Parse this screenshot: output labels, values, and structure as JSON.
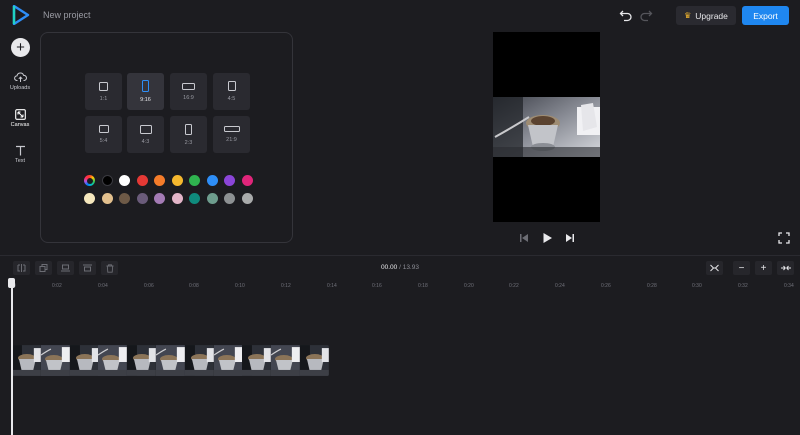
{
  "header": {
    "project_name": "New project",
    "upgrade_label": "Upgrade",
    "export_label": "Export",
    "upgrade_icon": "crown-icon",
    "brand_color": "#1f87f0"
  },
  "sidebar": {
    "add_icon": "plus-icon",
    "items": [
      {
        "label": "Uploads",
        "icon": "cloud-upload-icon"
      },
      {
        "label": "Canvas",
        "icon": "canvas-resize-icon"
      },
      {
        "label": "Text",
        "icon": "text-icon"
      }
    ]
  },
  "canvas_panel": {
    "aspect_ratios": [
      "1:1",
      "9:16",
      "16:9",
      "4:5",
      "5:4",
      "4:3",
      "2:3",
      "21:9"
    ],
    "selected_ratio": "9:16",
    "color_row_1": [
      "#000000",
      "#ffffff",
      "#e53935",
      "#f57c2a",
      "#f5b82e",
      "#2fb34f",
      "#2e8ef7",
      "#8b45d8",
      "#e0257a"
    ],
    "color_row_2": [
      "#f5e7bd",
      "#e3c08e",
      "#6e5a47",
      "#6a5b7a",
      "#a47bb5",
      "#e3b5c8",
      "#0f8b7d",
      "#6e9d8e",
      "#8d9193",
      "#a9abab"
    ]
  },
  "player": {
    "previous_icon": "skip-back-icon",
    "play_icon": "play-icon",
    "next_icon": "skip-forward-icon",
    "fullscreen_icon": "fullscreen-icon"
  },
  "timeline": {
    "current_time": "00.00",
    "separator": " / ",
    "total_time": "13.93",
    "ruler_labels": [
      "0",
      "0:02",
      "0:04",
      "0:06",
      "0:08",
      "0:10",
      "0:12",
      "0:14",
      "0:16",
      "0:18",
      "0:20",
      "0:22",
      "0:24",
      "0:26",
      "0:28",
      "0:30",
      "0:32",
      "0:34"
    ],
    "tools": [
      "split-icon",
      "duplicate-icon",
      "align-bottom-icon",
      "align-top-icon",
      "delete-icon"
    ],
    "zoom_fit_icon": "fit-icon",
    "zoom_out_label": "−",
    "zoom_in_label": "+",
    "expand_icon": "expand-icon"
  }
}
